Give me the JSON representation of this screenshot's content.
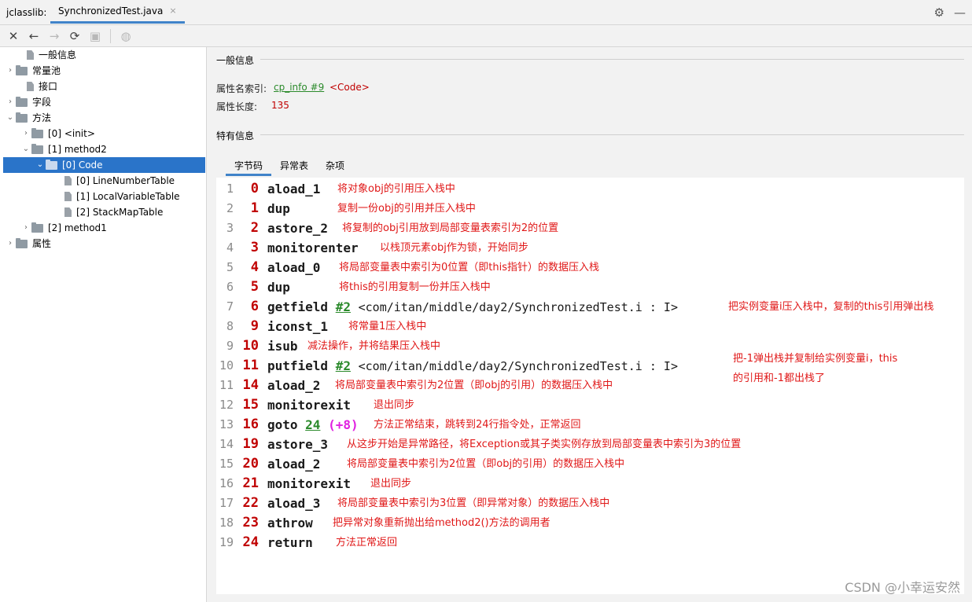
{
  "titlebar": {
    "app_name": "jclasslib:",
    "tab_title": "SynchronizedTest.java",
    "tab_close": "×"
  },
  "icons": {
    "settings": "gear-icon",
    "minimize": "minimize-icon",
    "close": "close-icon",
    "back": "back-arrow-icon",
    "forward": "forward-arrow-icon",
    "reload": "reload-icon",
    "save": "save-icon",
    "web": "globe-icon"
  },
  "tree": {
    "items": [
      {
        "label": "一般信息"
      },
      {
        "label": "常量池"
      },
      {
        "label": "接口"
      },
      {
        "label": "字段"
      },
      {
        "label": "方法"
      },
      {
        "label": "[0] <init>"
      },
      {
        "label": "[1] method2"
      },
      {
        "label": "[0] Code"
      },
      {
        "label": "[0] LineNumberTable"
      },
      {
        "label": "[1] LocalVariableTable"
      },
      {
        "label": "[2] StackMapTable"
      },
      {
        "label": "[2] method1"
      },
      {
        "label": "属性"
      }
    ]
  },
  "general": {
    "title": "一般信息",
    "name_index_label": "属性名索引:",
    "name_index_link": "cp_info #9",
    "name_index_value": "<Code>",
    "length_label": "属性长度:",
    "length_value": "135"
  },
  "specific": {
    "title": "特有信息",
    "tabs": [
      "字节码",
      "异常表",
      "杂项"
    ]
  },
  "bytecode": [
    {
      "line": "1",
      "offset": "0",
      "op": "aload_1",
      "comment": "将对象obj的引用压入栈中"
    },
    {
      "line": "2",
      "offset": "1",
      "op": "dup",
      "comment": "复制一份obj的引用并压入栈中"
    },
    {
      "line": "3",
      "offset": "2",
      "op": "astore_2",
      "comment": "将复制的obj引用放到局部变量表索引为2的位置"
    },
    {
      "line": "4",
      "offset": "3",
      "op": "monitorenter",
      "comment": "以栈顶元素obj作为锁，开始同步"
    },
    {
      "line": "5",
      "offset": "4",
      "op": "aload_0",
      "comment": "将局部变量表中索引为0位置（即this指针）的数据压入栈"
    },
    {
      "line": "6",
      "offset": "5",
      "op": "dup",
      "comment": "将this的引用复制一份并压入栈中"
    },
    {
      "line": "7",
      "offset": "6",
      "op": "getfield",
      "arg": "#2",
      "ref": "<com/itan/middle/day2/SynchronizedTest.i : I>",
      "comment": "把实例变量i压入栈中，复制的this引用弹出栈"
    },
    {
      "line": "8",
      "offset": "9",
      "op": "iconst_1",
      "comment": "将常量1压入栈中"
    },
    {
      "line": "9",
      "offset": "10",
      "op": "isub",
      "comment": "减法操作，并将结果压入栈中"
    },
    {
      "line": "10",
      "offset": "11",
      "op": "putfield",
      "arg": "#2",
      "ref": "<com/itan/middle/day2/SynchronizedTest.i : I>",
      "comment": "把-1弹出栈并复制给实例变量i，this",
      "comment2": "的引用和-1都出栈了"
    },
    {
      "line": "11",
      "offset": "14",
      "op": "aload_2",
      "comment": "将局部变量表中索引为2位置（即obj的引用）的数据压入栈中"
    },
    {
      "line": "12",
      "offset": "15",
      "op": "monitorexit",
      "comment": "退出同步"
    },
    {
      "line": "13",
      "offset": "16",
      "op": "goto",
      "arg": "24",
      "extra": "(+8)",
      "comment": "方法正常结束，跳转到24行指令处，正常返回"
    },
    {
      "line": "14",
      "offset": "19",
      "op": "astore_3",
      "comment": "从这步开始是异常路径，将Exception或其子类实例存放到局部变量表中索引为3的位置"
    },
    {
      "line": "15",
      "offset": "20",
      "op": "aload_2",
      "comment": "将局部变量表中索引为2位置（即obj的引用）的数据压入栈中"
    },
    {
      "line": "16",
      "offset": "21",
      "op": "monitorexit",
      "comment": "退出同步"
    },
    {
      "line": "17",
      "offset": "22",
      "op": "aload_3",
      "comment": "将局部变量表中索引为3位置（即异常对象）的数据压入栈中"
    },
    {
      "line": "18",
      "offset": "23",
      "op": "athrow",
      "comment": "把异常对象重新抛出给method2()方法的调用者"
    },
    {
      "line": "19",
      "offset": "24",
      "op": "return",
      "comment": "方法正常返回"
    }
  ],
  "watermark": "CSDN @小幸运安然"
}
